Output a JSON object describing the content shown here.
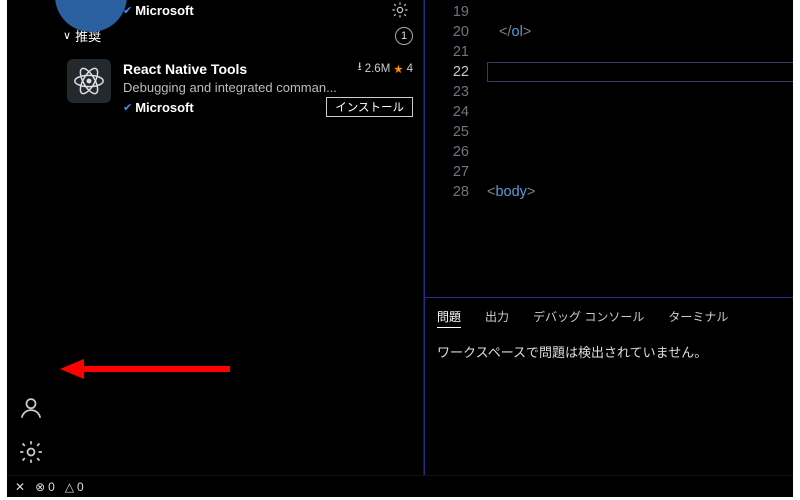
{
  "sidebar": {
    "top_publisher": "Microsoft",
    "section_label": "推奨",
    "section_count": "1",
    "item": {
      "title": "React Native Tools",
      "downloads": "2.6M",
      "rating": "4",
      "description": "Debugging and integrated comman...",
      "publisher": "Microsoft",
      "install_label": "インストール"
    }
  },
  "editor": {
    "lines": [
      "19",
      "20",
      "21",
      "22",
      "23",
      "24",
      "25",
      "26",
      "27",
      "28"
    ],
    "code20_close": "</",
    "code20_tag": "ol",
    "code20_end": ">",
    "code28_open": "<",
    "code28_tag": "body",
    "code28_end": ">"
  },
  "panel": {
    "tabs": {
      "problems": "問題",
      "output": "出力",
      "debug": "デバッグ コンソール",
      "terminal": "ターミナル"
    },
    "message": "ワークスペースで問題は検出されていません。"
  },
  "statusbar": {
    "errors": "0",
    "warnings": "0"
  },
  "icons": {
    "download": "⭳",
    "star": "★",
    "verified": "✔",
    "remote": "✕",
    "err": "⊗",
    "warn": "△"
  }
}
